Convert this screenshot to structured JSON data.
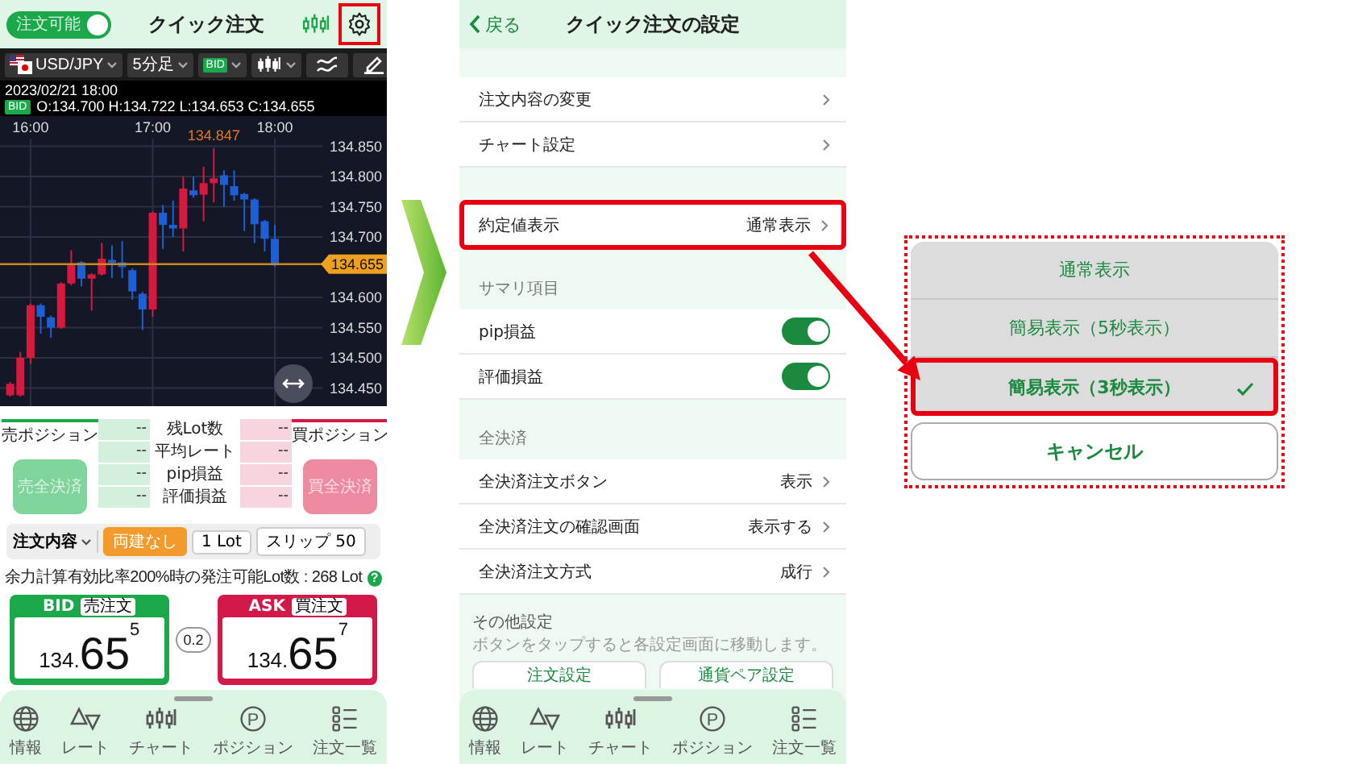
{
  "quick_order": {
    "header": {
      "toggle": {
        "label": "注文可能",
        "on": true
      },
      "title": "クイック注文",
      "settings_highlighted": true
    },
    "toolbar": {
      "pair": "USD/JPY",
      "timeframe": "5分足",
      "price_type": "BID"
    },
    "quote": {
      "datetime": "2023/02/21 18:00",
      "badge": "BID",
      "ohlc": "O:134.700 H:134.722 L:134.653 C:134.655"
    },
    "chart": {
      "chart_data": {
        "type": "candlestick",
        "grid": true,
        "x": [
          950,
          955,
          960,
          965,
          970,
          975,
          980,
          985,
          990,
          995,
          1000,
          1005,
          1010,
          1015,
          1020,
          1025,
          1030,
          1035,
          1040,
          1045,
          1050,
          1055,
          1060,
          1065,
          1070,
          1075,
          1080
        ],
        "ohlc": [
          [
            134.438,
            134.46,
            134.436,
            134.457
          ],
          [
            134.438,
            134.51,
            134.436,
            134.5
          ],
          [
            134.5,
            134.59,
            134.49,
            134.587
          ],
          [
            134.587,
            134.59,
            134.54,
            134.568
          ],
          [
            134.567,
            134.57,
            134.533,
            134.55
          ],
          [
            134.55,
            134.625,
            134.548,
            134.623
          ],
          [
            134.623,
            134.678,
            134.62,
            134.656
          ],
          [
            134.658,
            134.66,
            134.618,
            134.631
          ],
          [
            134.631,
            134.64,
            134.578,
            134.638
          ],
          [
            134.638,
            134.69,
            134.636,
            134.664
          ],
          [
            134.662,
            134.686,
            134.632,
            134.657
          ],
          [
            134.658,
            134.693,
            134.632,
            134.65
          ],
          [
            134.645,
            134.648,
            134.596,
            134.61
          ],
          [
            134.606,
            134.609,
            134.546,
            134.58
          ],
          [
            134.58,
            134.742,
            134.568,
            134.74
          ],
          [
            134.74,
            134.753,
            134.68,
            134.72
          ],
          [
            134.72,
            134.76,
            134.7,
            134.714
          ],
          [
            134.714,
            134.8,
            134.676,
            134.78
          ],
          [
            134.777,
            134.8,
            134.765,
            134.769
          ],
          [
            134.77,
            134.816,
            134.726,
            134.789
          ],
          [
            134.789,
            134.847,
            134.757,
            134.797
          ],
          [
            134.802,
            134.81,
            134.75,
            134.786
          ],
          [
            134.784,
            134.81,
            134.76,
            134.769
          ],
          [
            134.771,
            134.773,
            134.71,
            134.762
          ],
          [
            134.762,
            134.764,
            134.69,
            134.721
          ],
          [
            134.726,
            134.728,
            134.676,
            134.697
          ],
          [
            134.697,
            134.72,
            134.651,
            134.653
          ]
        ],
        "xticks": [
          {
            "value": 960,
            "label": "16:00"
          },
          {
            "value": 1020,
            "label": "17:00"
          },
          {
            "value": 1080,
            "label": "18:00"
          }
        ],
        "xlim": [
          945,
          1135
        ],
        "ref_lines": [
          {
            "axis": "y",
            "value": 134.655,
            "label": "134.655",
            "color": "#c98a1a"
          }
        ],
        "annotations": [
          {
            "x": 1050,
            "y": 134.847,
            "text": "134.847"
          }
        ],
        "yticks": [
          {
            "value": 134.85,
            "label": "134.850"
          },
          {
            "value": 134.8,
            "label": "134.800"
          },
          {
            "value": 134.75,
            "label": "134.750"
          },
          {
            "value": 134.7,
            "label": "134.700"
          },
          {
            "value": 134.6,
            "label": "134.600"
          },
          {
            "value": 134.55,
            "label": "134.550"
          },
          {
            "value": 134.5,
            "label": "134.500"
          },
          {
            "value": 134.45,
            "label": "134.450"
          }
        ],
        "ylim": [
          134.42,
          134.9
        ]
      }
    },
    "positions": {
      "sell": {
        "label": "売ポジション",
        "button": "売全決済",
        "disabled": true
      },
      "buy": {
        "label": "買ポジション",
        "button": "買全決済",
        "disabled": true
      },
      "rows": [
        {
          "label": "残Lot数",
          "sell": "--",
          "buy": "--"
        },
        {
          "label": "平均レート",
          "sell": "--",
          "buy": "--"
        },
        {
          "label": "pip損益",
          "sell": "--",
          "buy": "--"
        },
        {
          "label": "評価損益",
          "sell": "--",
          "buy": "--"
        }
      ]
    },
    "order_bar": {
      "label": "注文内容",
      "chips": [
        {
          "label": "両建なし",
          "kind": "accent"
        },
        {
          "label": "1 Lot",
          "kind": "plain"
        },
        {
          "label": "スリップ 50",
          "kind": "plain"
        }
      ]
    },
    "available_lots": {
      "text": "余力計算有効比率200%時の発注可能Lot数 : 268 Lot",
      "help": "?"
    },
    "bid": {
      "label": "BID",
      "tag": "売注文",
      "price_prefix": "134.",
      "price_main": "65",
      "price_fraction": "5"
    },
    "spread": "0.2",
    "ask": {
      "label": "ASK",
      "tag": "買注文",
      "price_prefix": "134.",
      "price_main": "65",
      "price_fraction": "7"
    },
    "nav": [
      {
        "label": "情報"
      },
      {
        "label": "レート"
      },
      {
        "label": "チャート"
      },
      {
        "label": "ポジション",
        "glyph": "P"
      },
      {
        "label": "注文一覧"
      }
    ]
  },
  "settings": {
    "back": "戻る",
    "title": "クイック注文の設定",
    "groups": [
      {
        "items": [
          {
            "label": "注文内容の変更",
            "kind": "link",
            "highlighted": false
          },
          {
            "label": "チャート設定",
            "kind": "link",
            "highlighted": false
          }
        ]
      },
      {
        "items": [
          {
            "label": "約定値表示",
            "value": "通常表示",
            "kind": "link",
            "highlighted": true
          }
        ]
      },
      {
        "heading": "サマリ項目",
        "items": [
          {
            "label": "pip損益",
            "kind": "toggle",
            "on": true,
            "highlighted": false
          },
          {
            "label": "評価損益",
            "kind": "toggle",
            "on": true,
            "highlighted": false
          }
        ]
      },
      {
        "heading": "全決済",
        "items": [
          {
            "label": "全決済注文ボタン",
            "value": "表示",
            "kind": "link",
            "highlighted": false
          },
          {
            "label": "全決済注文の確認画面",
            "value": "表示する",
            "kind": "link",
            "highlighted": false
          },
          {
            "label": "全決済注文方式",
            "value": "成行",
            "kind": "link",
            "highlighted": false
          }
        ]
      },
      {
        "heading": "その他設定",
        "note": "ボタンをタップすると各設定画面に移動します。",
        "buttons": [
          "注文設定",
          "通貨ペア設定"
        ]
      }
    ],
    "nav": [
      {
        "label": "情報"
      },
      {
        "label": "レート"
      },
      {
        "label": "チャート"
      },
      {
        "label": "ポジション",
        "glyph": "P"
      },
      {
        "label": "注文一覧"
      }
    ]
  },
  "picker": {
    "highlighted": true,
    "options": [
      {
        "label": "通常表示",
        "selected": false,
        "highlighted": false
      },
      {
        "label": "簡易表示（5秒表示）",
        "selected": false,
        "highlighted": false
      },
      {
        "label": "簡易表示（3秒表示）",
        "selected": true,
        "highlighted": true
      }
    ],
    "cancel": "キャンセル"
  }
}
